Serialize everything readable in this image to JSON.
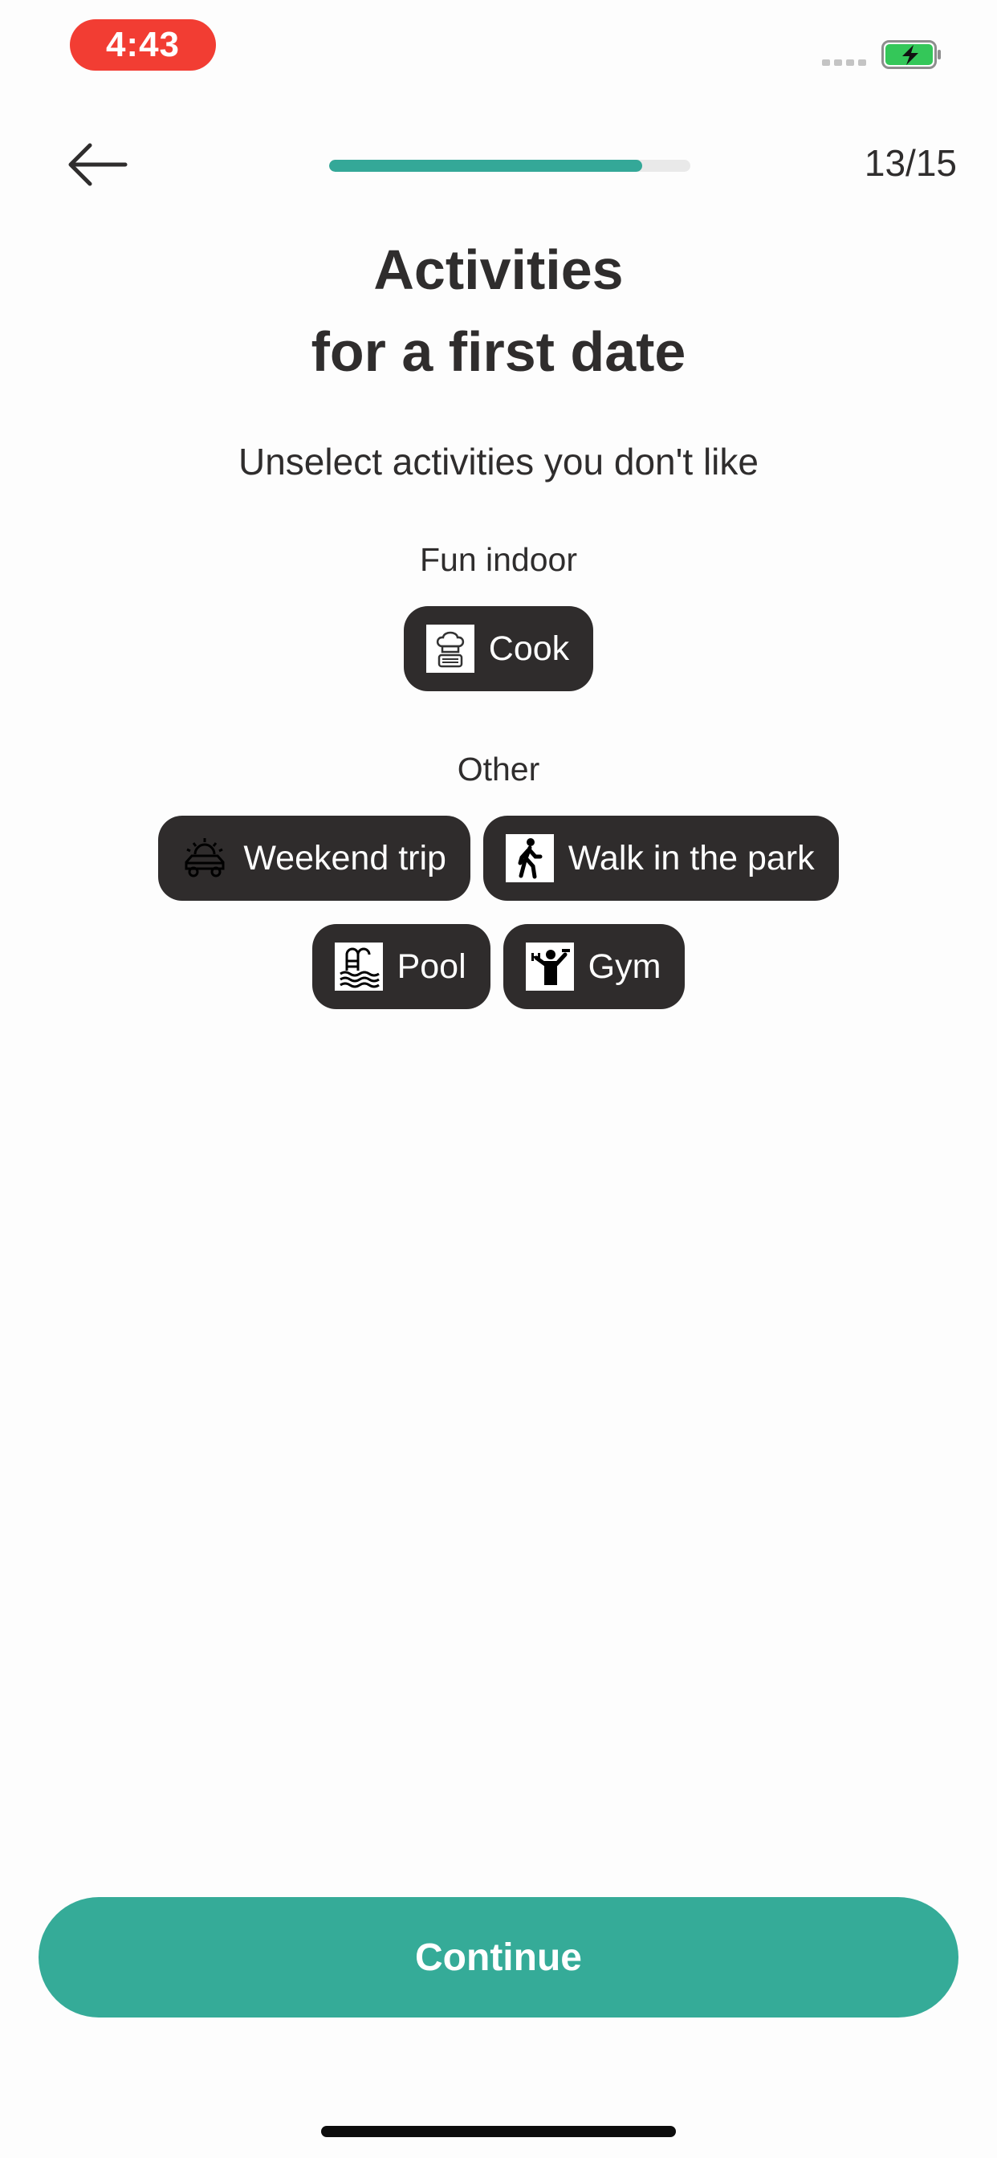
{
  "status_bar": {
    "time": "4:43",
    "time_pill_color": "#f23d33",
    "battery_icon": "battery-charging-icon",
    "battery_color": "#34c759"
  },
  "header": {
    "back_icon": "arrow-left-icon",
    "progress_fraction": 0.867,
    "step_counter": "13/15",
    "accent_color": "#34a898"
  },
  "title_line1": "Activities",
  "title_line2": "for a first date",
  "subtitle": "Unselect activities you don't like",
  "sections": [
    {
      "label": "Fun indoor",
      "chips": [
        {
          "label": "Cook",
          "icon": "chef-hat-icon",
          "selected": true
        }
      ]
    },
    {
      "label": "Other",
      "chips": [
        {
          "label": "Weekend trip",
          "icon": "car-sun-icon",
          "selected": true
        },
        {
          "label": "Walk in the park",
          "icon": "walking-person-icon",
          "selected": true
        },
        {
          "label": "Pool",
          "icon": "swimming-pool-icon",
          "selected": true
        },
        {
          "label": "Gym",
          "icon": "weightlifter-icon",
          "selected": true
        }
      ]
    }
  ],
  "continue_label": "Continue",
  "continue_color": "#35ab98"
}
